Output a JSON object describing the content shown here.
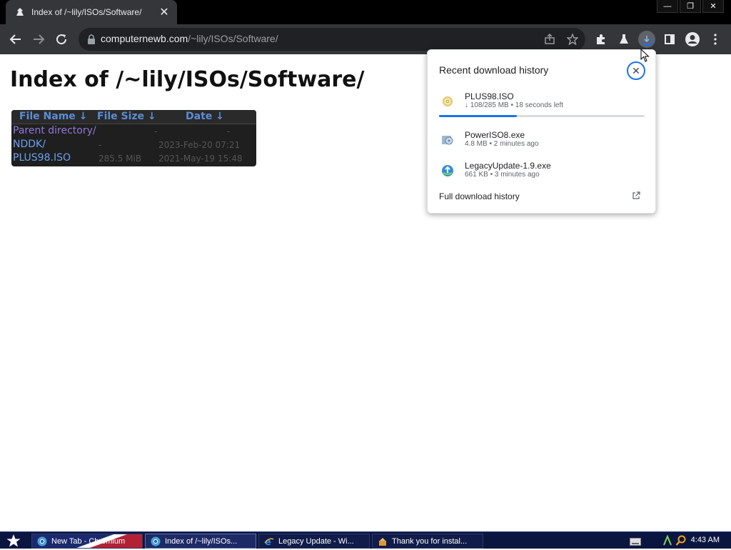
{
  "browser": {
    "tab": {
      "title": "Index of /~lily/ISOs/Software/",
      "favicon": "lily-favicon-icon"
    },
    "window_controls": {
      "minimize": "—",
      "restore": "❐",
      "close": "✕"
    },
    "address": {
      "host": "computernewb.com",
      "path": "/~lily/ISOs/Software/"
    },
    "icons": [
      "back-arrow-icon",
      "forward-arrow-icon",
      "reload-icon",
      "lock-icon",
      "share-icon",
      "bookmark-star-icon",
      "extensions-puzzle-icon",
      "labs-flask-icon",
      "download-progress-icon",
      "side-panel-icon",
      "profile-avatar-icon",
      "more-menu-icon"
    ]
  },
  "page": {
    "heading": "Index of /~lily/ISOs/Software/",
    "columns": {
      "name": "File Name  ↓",
      "size": "File Size  ↓",
      "date": "Date  ↓"
    },
    "rows": [
      {
        "name": "Parent directory/",
        "size": "-",
        "date": "-"
      },
      {
        "name": "NDDK/",
        "size": "-",
        "date": "2023-Feb-20 07:21"
      },
      {
        "name": "PLUS98.ISO",
        "size": "285.5 MiB",
        "date": "2021-May-19 15:48"
      }
    ]
  },
  "downloads": {
    "heading": "Recent download history",
    "close_symbol": "✕",
    "items": [
      {
        "name": "PLUS98.ISO",
        "meta": "↓  108/285 MB • 18 seconds left",
        "icon": "cd-disc-icon",
        "progress": 0.38
      },
      {
        "name": "PowerISO8.exe",
        "meta": "4.8 MB • 2 minutes ago",
        "icon": "poweriso-app-icon"
      },
      {
        "name": "LegacyUpdate-1.9.exe",
        "meta": "661 KB • 3 minutes ago",
        "icon": "legacy-update-globe-icon"
      }
    ],
    "full_history": "Full download history",
    "accent": "#1a73e8"
  },
  "taskbar": {
    "tasks": [
      {
        "label": "New Tab - Chromium",
        "icon": "chromium-icon"
      },
      {
        "label": "Index of /~lily/ISOs...",
        "icon": "chromium-icon"
      },
      {
        "label": "Legacy Update - Wi...",
        "icon": "internet-explorer-icon"
      },
      {
        "label": "Thank you for instal...",
        "icon": "setup-wizard-icon"
      }
    ],
    "clock": "4:43 AM"
  }
}
